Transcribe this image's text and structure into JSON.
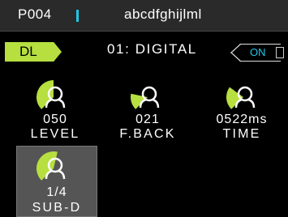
{
  "header": {
    "patch_number": "P004",
    "patch_name": "abcdfghijlml"
  },
  "effect": {
    "tag": "DL",
    "name": "01: DIGITAL",
    "onoff": "ON"
  },
  "params": [
    {
      "value": "050",
      "label": "LEVEL",
      "level": 0.5
    },
    {
      "value": "021",
      "label": "F.BACK",
      "level": 0.21
    },
    {
      "value": "0522ms",
      "label": "TIME",
      "level": 0.3
    }
  ],
  "sub": {
    "value": "1/4",
    "label": "SUB-D",
    "level": 0.55
  },
  "colors": {
    "accent": "#b6df3f",
    "cursor": "#1ec6e8",
    "sub_bg": "#555555"
  }
}
